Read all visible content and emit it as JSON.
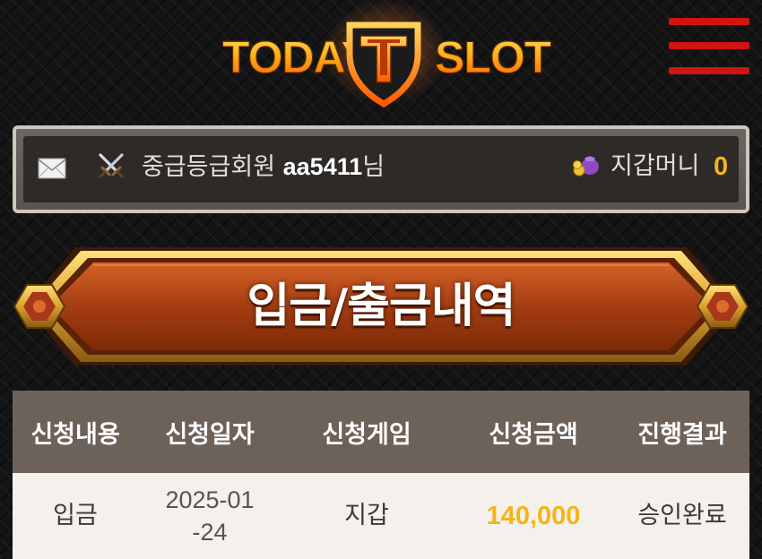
{
  "header": {
    "logo_left": "TODAY",
    "logo_right": "SLOT",
    "menu_icon": "hamburger-menu-icon"
  },
  "user_bar": {
    "mail_icon": "mail-envelope-icon",
    "grade_icon": "crossed-swords-icon",
    "grade_label": "중급등급회원",
    "username": "aa5411",
    "honorific": "님",
    "wallet_icon": "coin-bag-icon",
    "wallet_label": "지갑머니",
    "wallet_amount": "0"
  },
  "banner": {
    "title": "입금/출금내역"
  },
  "table": {
    "headers": [
      "신청내용",
      "신청일자",
      "신청게임",
      "신청금액",
      "진행결과"
    ],
    "rows": [
      {
        "type": "입금",
        "date": "2025-01-24",
        "game": "지갑",
        "amount": "140,000",
        "result": "승인완료"
      }
    ]
  },
  "colors": {
    "menu_red": "#d11313",
    "gold": "#f2b51a",
    "banner_orange": "#b74a17",
    "table_header_bg": "#6d625a",
    "table_row_bg": "#f4f0eb"
  }
}
